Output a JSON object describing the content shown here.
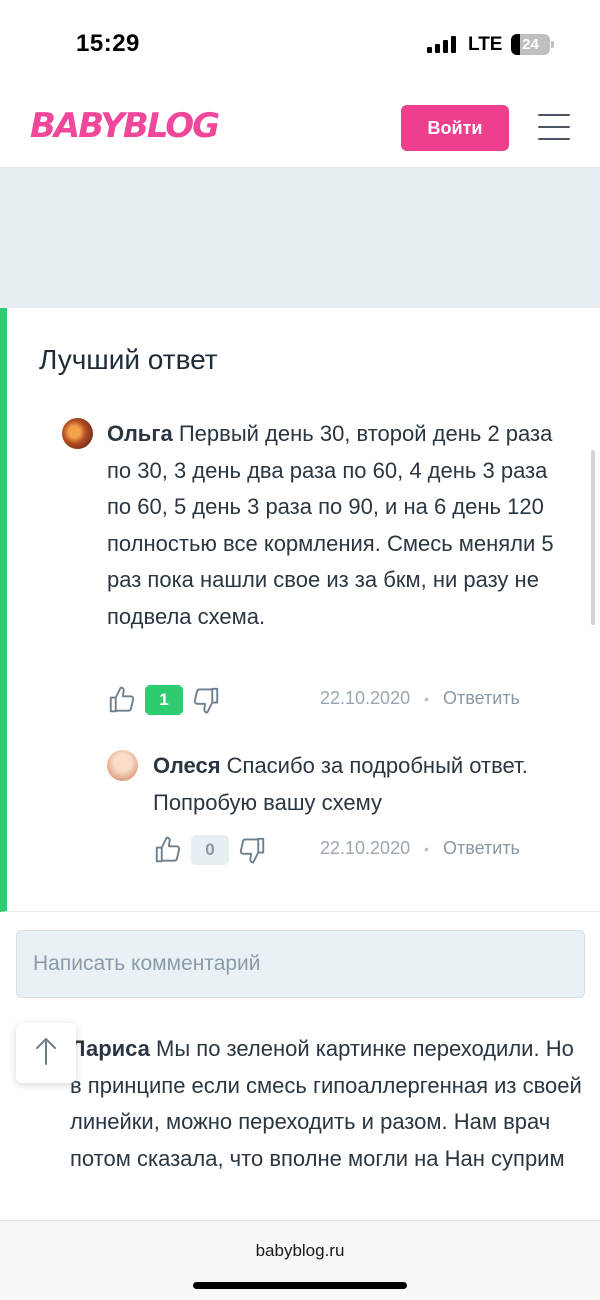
{
  "status_bar": {
    "time": "15:29",
    "network": "LTE",
    "battery": "24"
  },
  "header": {
    "logo": "BABYBLOG",
    "login_label": "Войти"
  },
  "best_answer": {
    "title": "Лучший ответ",
    "comment": {
      "author": "Ольга",
      "text": " Первый день 30, второй день 2 раза по 30, 3 день два раза по 60, 4 день 3 раза по 60, 5 день 3 раза по 90, и на 6 день 120 полностью все кормления. Смесь меняли 5 раз пока нашли свое из за бкм, ни разу не подвела схема.",
      "likes": "1",
      "date": "22.10.2020",
      "dot": "•",
      "reply": "Ответить"
    },
    "reply": {
      "author": "Олеся",
      "text": " Спасибо за подробный ответ. Попробую вашу схему",
      "likes": "0",
      "date": "22.10.2020",
      "dot": "•",
      "reply": "Ответить"
    }
  },
  "comment_input": {
    "placeholder": "Написать комментарий"
  },
  "next_comment": {
    "author": "Лариса",
    "text": " Мы по зеленой картинке переходили. Но в принципе если смесь гипоаллергенная из своей линейки, можно переходить и разом. Нам врач потом сказала, что вполне могли на Нан суприм"
  },
  "browser": {
    "url": "babyblog.ru"
  },
  "colors": {
    "brand": "#ee3f8d",
    "accent_green": "#2ecc71"
  },
  "icons": [
    "thumbs-up-icon",
    "thumbs-down-icon",
    "arrow-up-icon",
    "hamburger-menu-icon",
    "signal-icon",
    "battery-icon"
  ]
}
